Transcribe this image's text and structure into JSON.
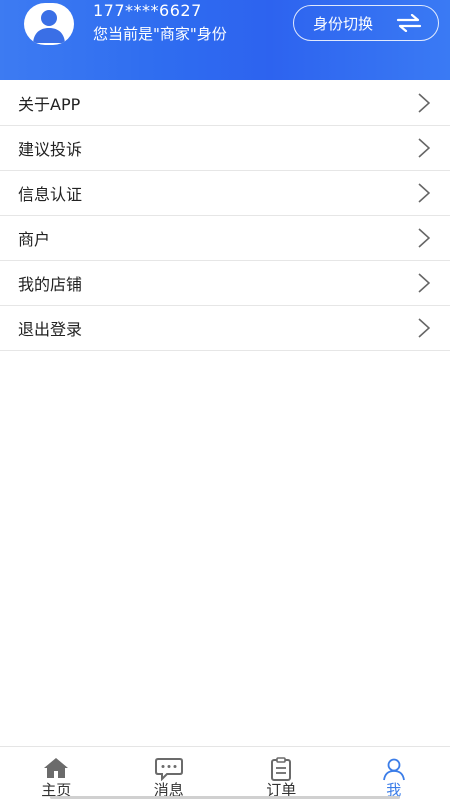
{
  "header": {
    "phone": "177****6627",
    "identity_text": "您当前是\"商家\"身份",
    "switch_label": "身份切换",
    "avatar_icon": "user-avatar-icon",
    "switch_icon": "swap-arrows-icon"
  },
  "menu": {
    "items": [
      {
        "label": "关于APP",
        "icon": "chevron-right-icon"
      },
      {
        "label": "建议投诉",
        "icon": "chevron-right-icon"
      },
      {
        "label": "信息认证",
        "icon": "chevron-right-icon"
      },
      {
        "label": "商户",
        "icon": "chevron-right-icon"
      },
      {
        "label": "我的店铺",
        "icon": "chevron-right-icon"
      },
      {
        "label": "退出登录",
        "icon": "chevron-right-icon"
      }
    ]
  },
  "tabbar": {
    "tabs": [
      {
        "label": "主页",
        "icon": "home-icon",
        "active": false
      },
      {
        "label": "消息",
        "icon": "message-icon",
        "active": false
      },
      {
        "label": "订单",
        "icon": "order-clipboard-icon",
        "active": false
      },
      {
        "label": "我",
        "icon": "profile-icon",
        "active": true
      }
    ]
  },
  "colors": {
    "header_blue": "#2f6df0",
    "active_tab": "#3b7de8",
    "inactive_icon": "#6b6b6b"
  }
}
